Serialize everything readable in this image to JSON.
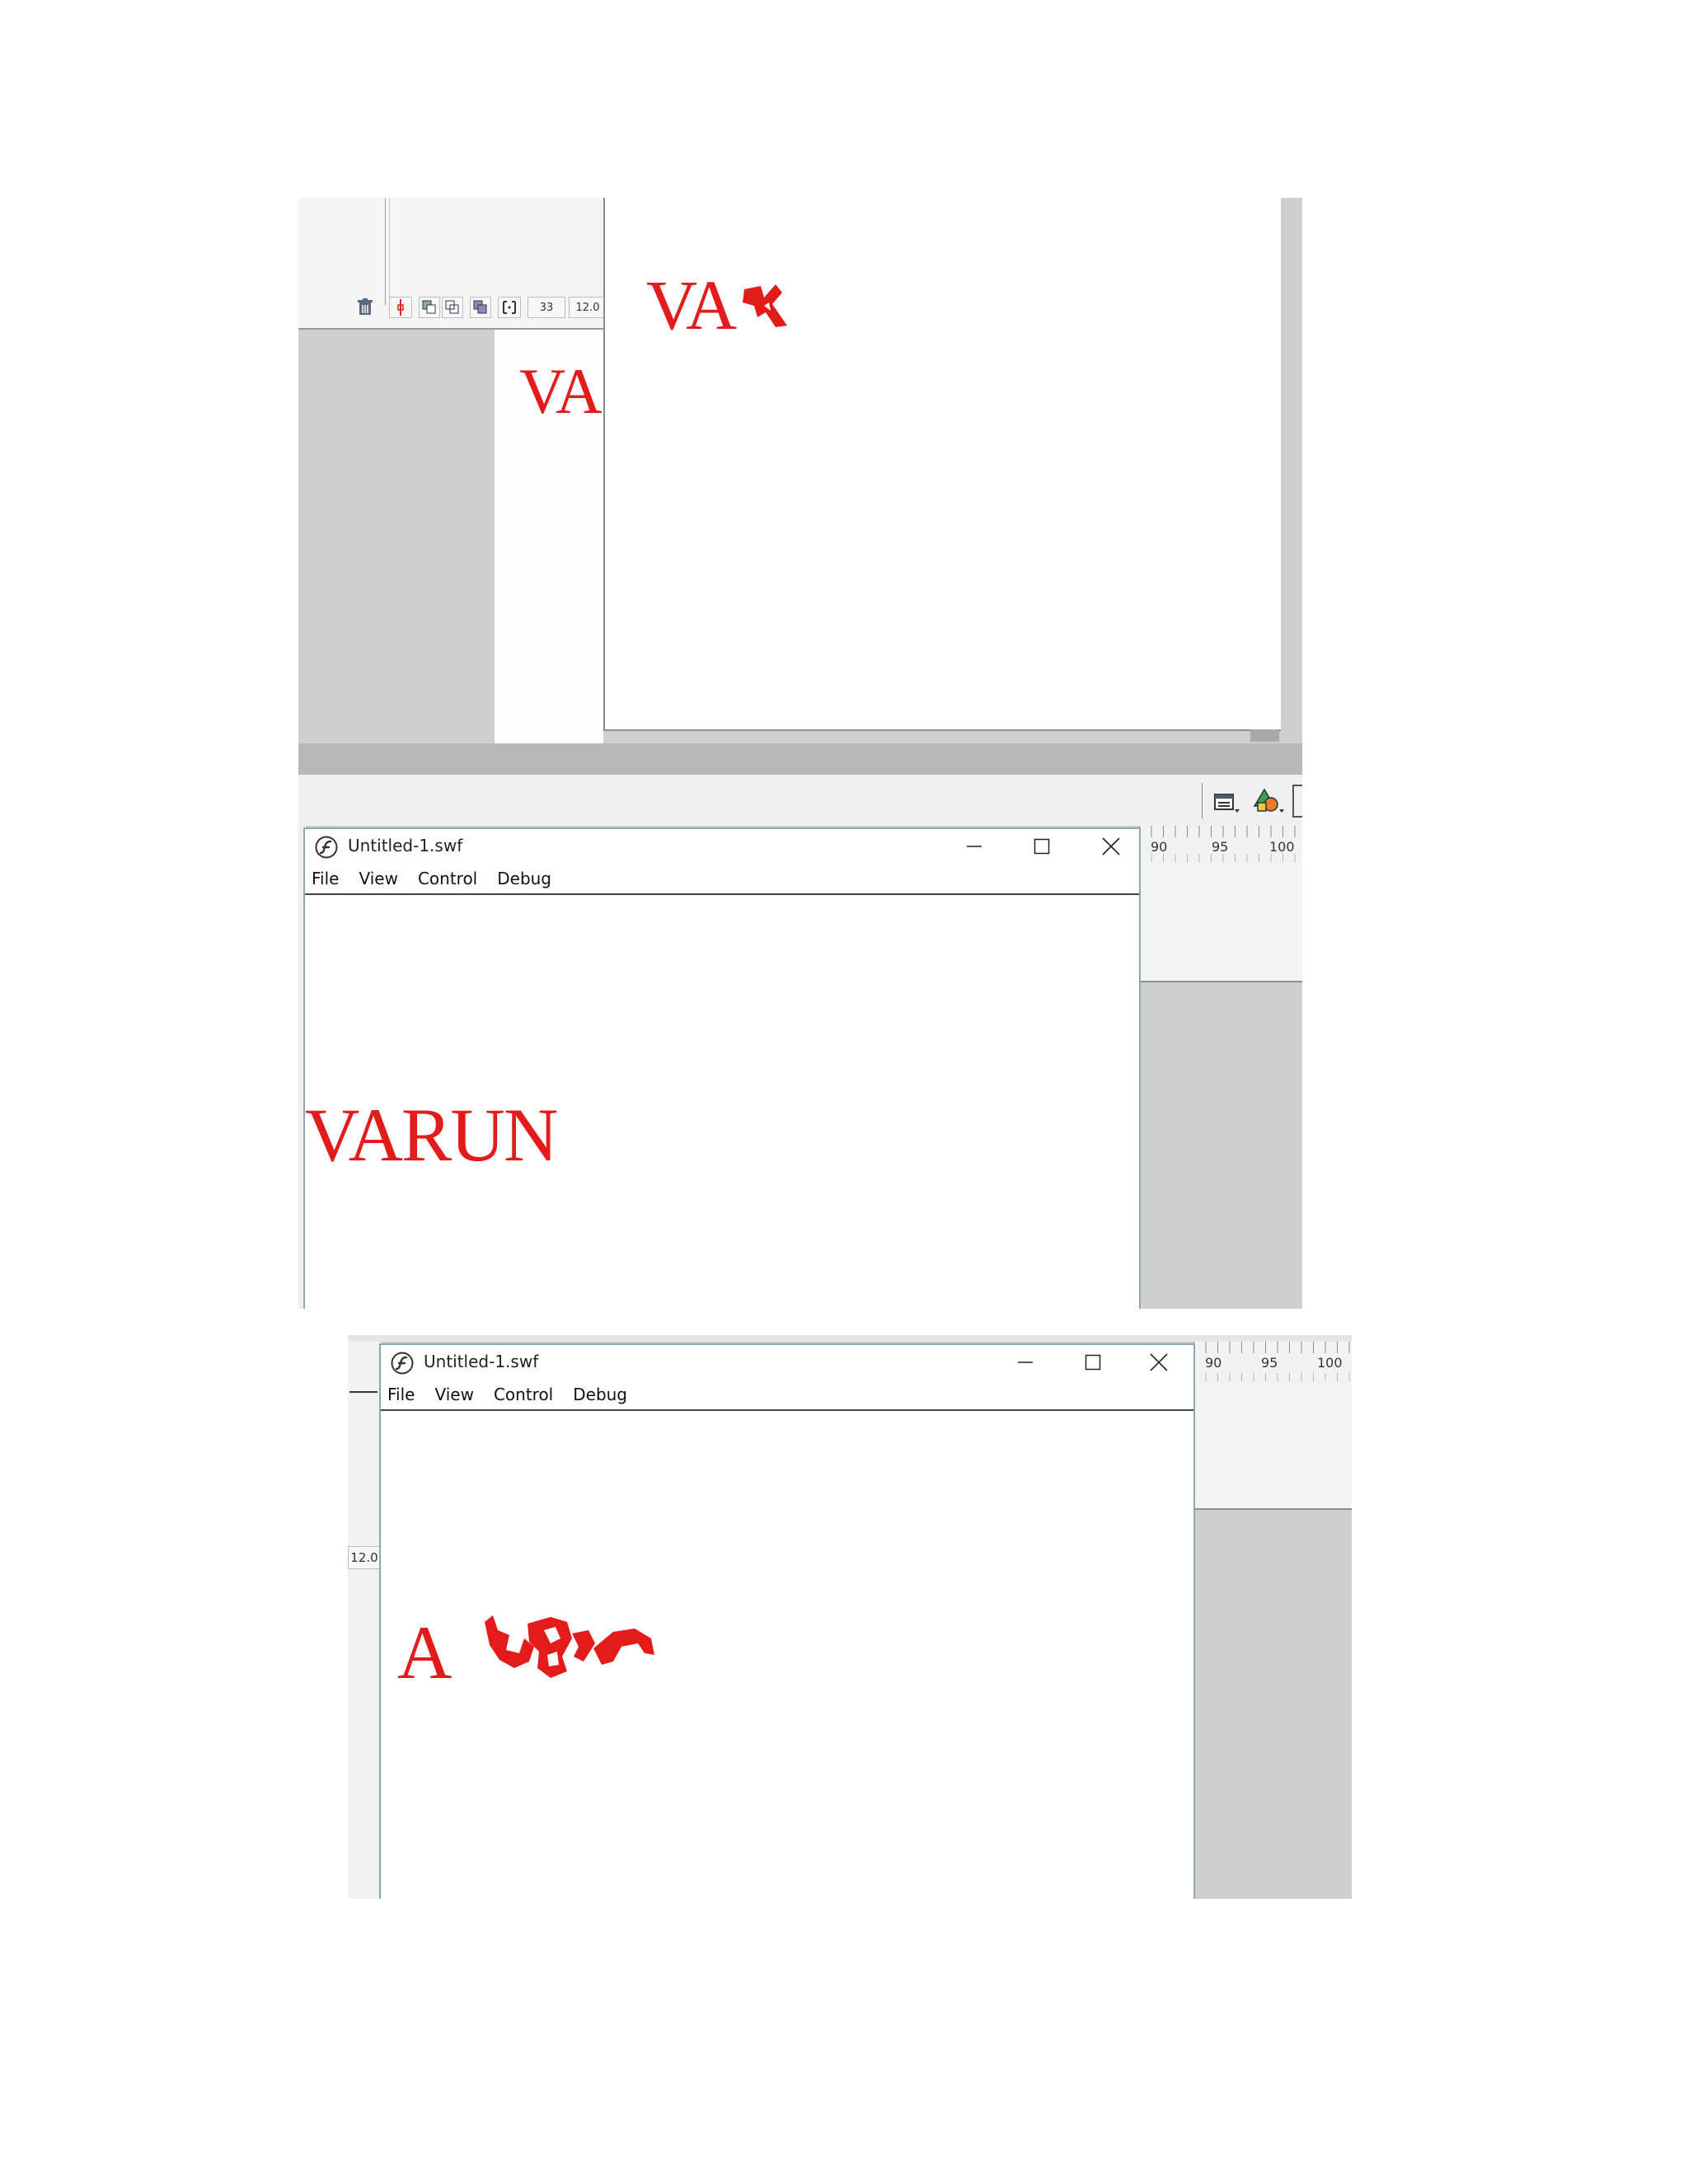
{
  "screenshot1": {
    "timeline_controls": {
      "frame_number": "33",
      "frame_rate": "12.0"
    },
    "stage_text_behind": "VA",
    "stage_text_front": "VA",
    "colors": {
      "text_red": "#e41b1b",
      "panel_gray": "#cfcfcf"
    }
  },
  "screenshot2": {
    "window": {
      "title": "Untitled-1.swf",
      "menu": [
        "File",
        "View",
        "Control",
        "Debug"
      ]
    },
    "ruler_labels": [
      "90",
      "95",
      "100"
    ],
    "movie_text": "VARUN"
  },
  "screenshot3": {
    "window": {
      "title": "Untitled-1.swf",
      "menu": [
        "File",
        "View",
        "Control",
        "Debug"
      ]
    },
    "ruler_labels": [
      "90",
      "95",
      "100"
    ],
    "frame_rate": "12.0",
    "movie_text": "A"
  }
}
